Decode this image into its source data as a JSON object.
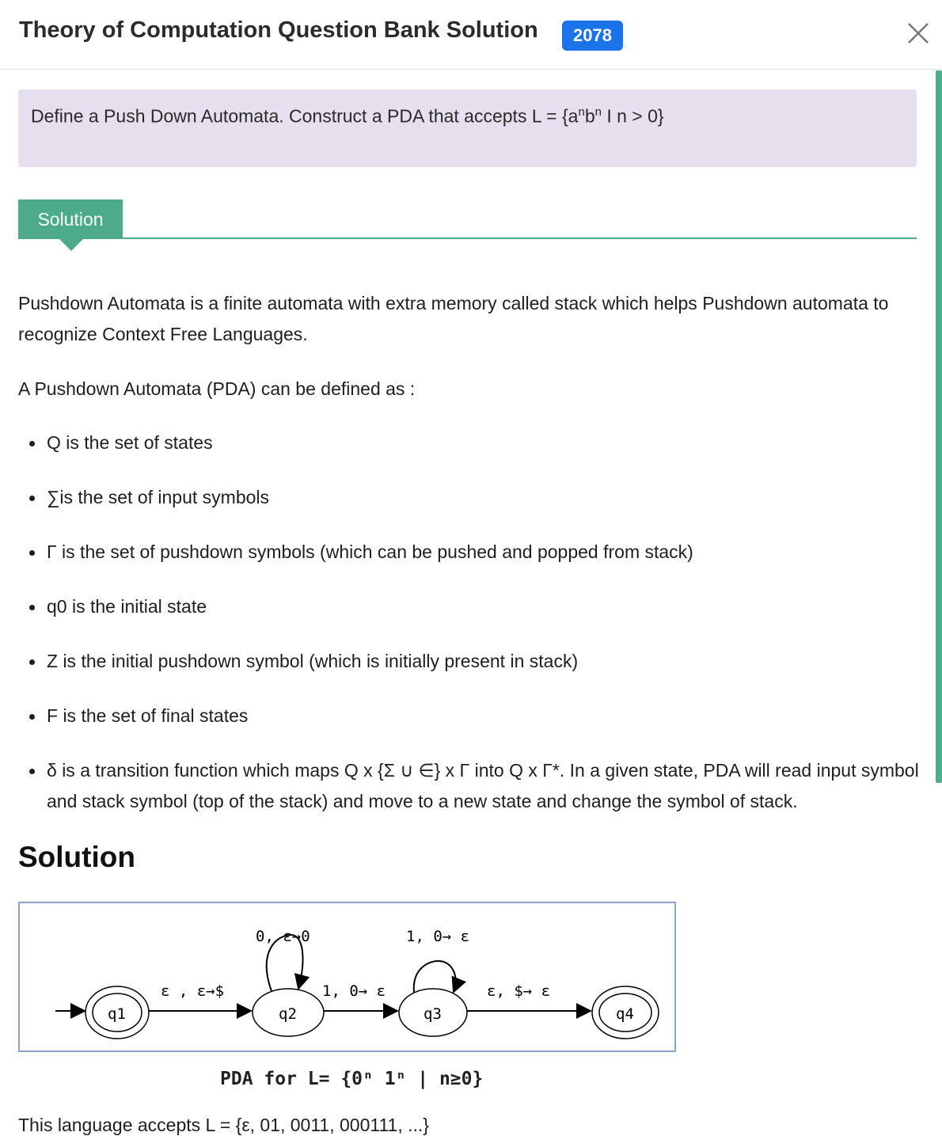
{
  "header": {
    "title": "Theory of Computation Question Bank Solution",
    "badge": "2078"
  },
  "question": {
    "text_prefix": "Define a Push Down Automata. Construct a PDA that accepts L = {a",
    "sup1": "n",
    "text_mid": "b",
    "sup2": "n",
    "text_suffix": " I n > 0}"
  },
  "solution_tab": "Solution",
  "intro": "Pushdown Automata is a finite automata with extra memory called stack which helps Pushdown automata to recognize Context Free Languages.",
  "definition_lead": "A Pushdown Automata (PDA) can be defined as :",
  "definition_items": [
    "Q is the set of states",
    "∑is the set of input symbols",
    "Γ is the set of pushdown symbols (which can be pushed and popped from stack)",
    "q0 is the initial state",
    "Z is the initial pushdown symbol (which is initially present in stack)",
    "F is the set of final states",
    "δ is a transition function which maps Q x {Σ ∪ ∈} x Γ into Q x Γ*. In a given state, PDA will read input symbol and stack symbol (top of the stack) and move to a new state and change the symbol of stack."
  ],
  "solution_heading": "Solution",
  "diagram": {
    "states": [
      "q1",
      "q2",
      "q3",
      "q4"
    ],
    "transitions": {
      "q1_q2": "ε , ε→$",
      "q2_loop": "0, ε→0",
      "q2_q3": "1, 0→ ε",
      "q3_loop": "1, 0→ ε",
      "q3_q4": "ε, $→ ε"
    },
    "caption": "PDA for L= {0ⁿ 1ⁿ | n≥0}"
  },
  "cut_text": "This language accepts L = {ε, 01, 0011, 000111, ...}"
}
